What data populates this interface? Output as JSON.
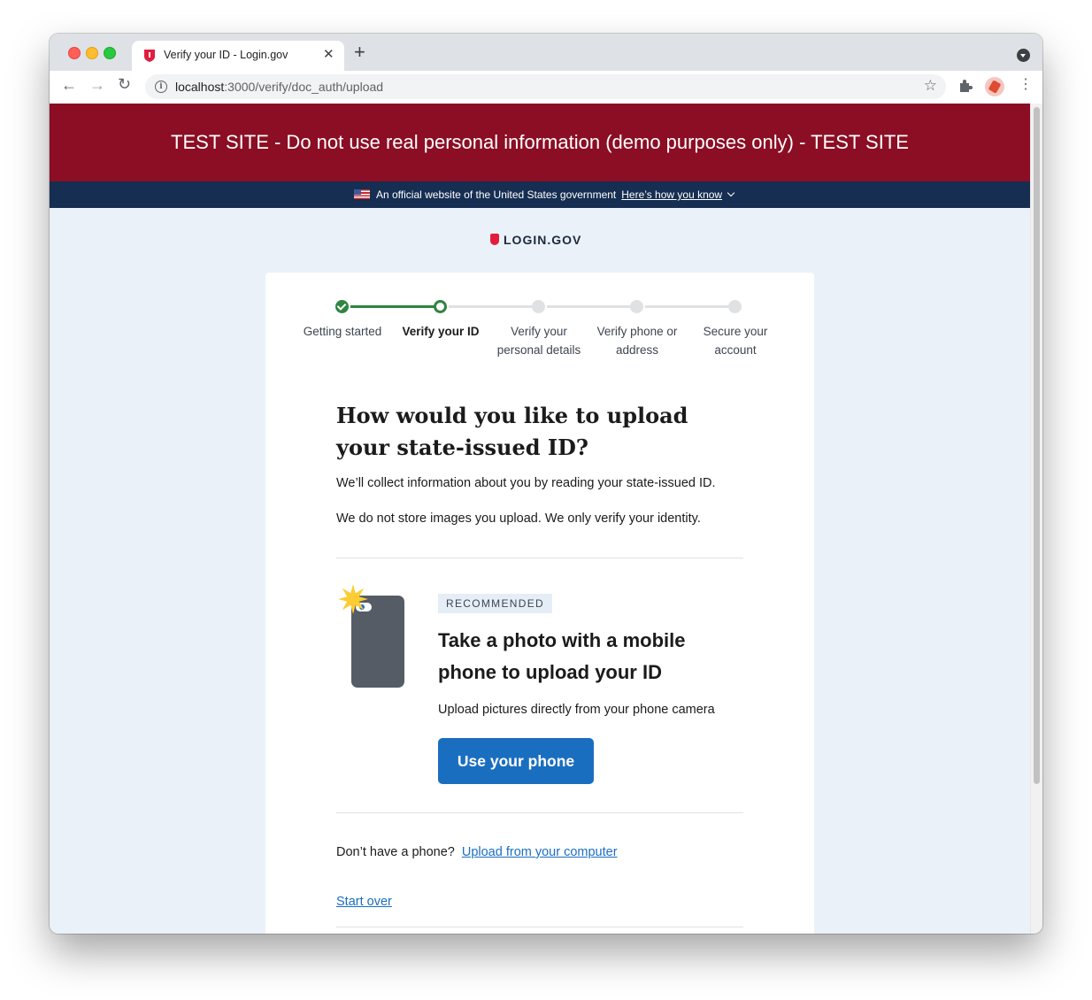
{
  "browser": {
    "tab_title": "Verify your ID - Login.gov",
    "tab_close": "✕",
    "new_tab": "+",
    "url_host": "localhost",
    "url_path": ":3000/verify/doc_auth/upload",
    "icons": {
      "back": "←",
      "forward": "→",
      "reload": "↻",
      "star": "☆",
      "menu": "⋮",
      "info": "i"
    }
  },
  "test_banner": "TEST SITE - Do not use real personal information (demo purposes only) - TEST SITE",
  "gov_banner": {
    "text": "An official website of the United States government",
    "link": "Here’s how you know"
  },
  "logo": "LOGIN.GOV",
  "steps": [
    {
      "label": "Getting started",
      "status": "complete"
    },
    {
      "label": "Verify your ID",
      "status": "current"
    },
    {
      "label": "Verify your personal details",
      "status": "future"
    },
    {
      "label": "Verify phone or address",
      "status": "future"
    },
    {
      "label": "Secure your account",
      "status": "future"
    }
  ],
  "main": {
    "heading": "How would you like to upload your state-issued ID?",
    "intro": "We’ll collect information about you by reading your state-issued ID.",
    "privacy": "We do not store images you upload. We only verify your identity.",
    "option": {
      "badge": "RECOMMENDED",
      "title": "Take a photo with a mobile phone to upload your ID",
      "description": "Upload pictures directly from your phone camera",
      "button": "Use your phone"
    },
    "no_phone_text": "Don’t have a phone?",
    "upload_link": "Upload from your computer",
    "start_over": "Start over"
  },
  "colors": {
    "test_banner_bg": "#8b0e24",
    "gov_banner_bg": "#162e51",
    "page_bg": "#eaf1f8",
    "primary": "#1a6ec0",
    "step_complete": "#2e8540"
  }
}
